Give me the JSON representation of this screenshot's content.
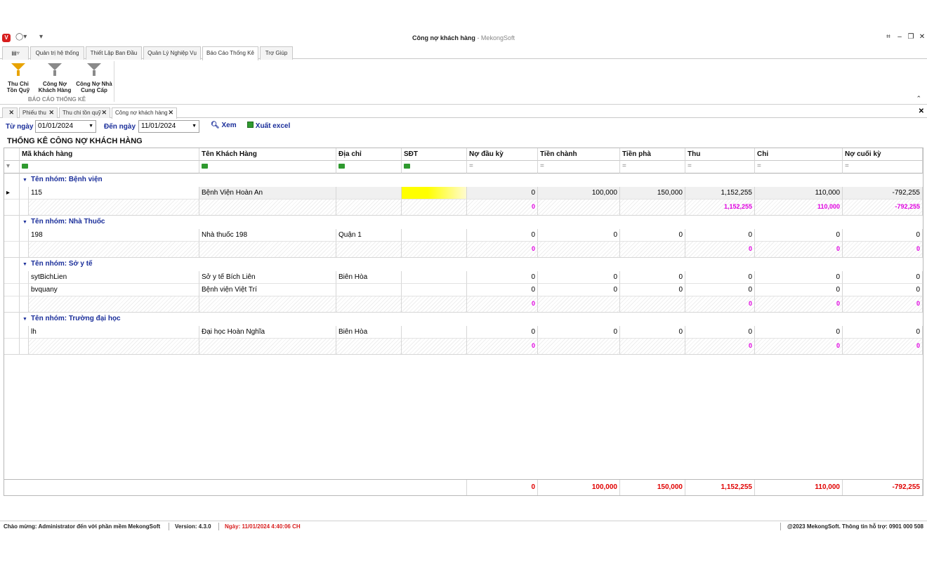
{
  "window": {
    "title": "Công nợ khách hàng",
    "app_suffix": "- MekongSoft",
    "logo": "V"
  },
  "ribbon": {
    "tabs": [
      "Quản trị hệ thống",
      "Thiết Lập Ban Đầu",
      "Quản Lý Nghiệp Vụ",
      "Báo Cáo Thống Kê",
      "Trợ Giúp"
    ],
    "active_tab": "Báo Cáo Thống Kê",
    "buttons": [
      {
        "line1": "Thu Chi",
        "line2": "Tồn Quỹ",
        "icon": "funnel-orange-icon"
      },
      {
        "line1": "Công Nợ",
        "line2": "Khách Hàng",
        "icon": "funnel-chart-icon"
      },
      {
        "line1": "Công Nợ Nhà",
        "line2": "Cung Cấp",
        "icon": "funnel-clock-icon"
      }
    ],
    "group_label": "BÁO CÁO THỐNG KÊ"
  },
  "doc_tabs": [
    "Phiếu thu",
    "Thu chi tồn quỹ",
    "Công nợ khách hàng"
  ],
  "filter": {
    "from_label": "Từ ngày",
    "from_value": "01/01/2024",
    "to_label": "Đến ngày",
    "to_value": "11/01/2024",
    "view_label": "Xem",
    "excel_label": "Xuất excel"
  },
  "report_title": "THỐNG KÊ CÔNG NỢ KHÁCH HÀNG",
  "columns": [
    "Mã khách hàng",
    "Tên Khách Hàng",
    "Địa chỉ",
    "SĐT",
    "Nợ đầu kỳ",
    "Tiền chành",
    "Tiền phà",
    "Thu",
    "Chi",
    "Nợ cuối kỳ"
  ],
  "groups": [
    {
      "label": "Tên nhóm: Bệnh viện",
      "rows": [
        {
          "ma": "115",
          "ten": "Bệnh Viện Hoàn An",
          "diachi": "",
          "sdt": "",
          "nodau": "0",
          "chanh": "100,000",
          "pha": "150,000",
          "thu": "1,152,255",
          "chi": "110,000",
          "nocuoi": "-792,255"
        }
      ],
      "sub": {
        "nodau": "0",
        "chanh": "",
        "pha": "",
        "thu": "1,152,255",
        "chi": "110,000",
        "nocuoi": "-792,255"
      }
    },
    {
      "label": "Tên nhóm: Nhà Thuốc",
      "rows": [
        {
          "ma": "198",
          "ten": "Nhà thuốc 198",
          "diachi": "Quận 1",
          "sdt": "",
          "nodau": "0",
          "chanh": "0",
          "pha": "0",
          "thu": "0",
          "chi": "0",
          "nocuoi": "0"
        }
      ],
      "sub": {
        "nodau": "0",
        "chanh": "",
        "pha": "",
        "thu": "0",
        "chi": "0",
        "nocuoi": "0"
      }
    },
    {
      "label": "Tên nhóm: Sở y tế",
      "rows": [
        {
          "ma": "sytBichLien",
          "ten": "Sở y tế  Bích Liên",
          "diachi": "Biên Hòa",
          "sdt": "",
          "nodau": "0",
          "chanh": "0",
          "pha": "0",
          "thu": "0",
          "chi": "0",
          "nocuoi": "0"
        },
        {
          "ma": "bvquany",
          "ten": "Bệnh viện Việt Trí",
          "diachi": "",
          "sdt": "",
          "nodau": "0",
          "chanh": "0",
          "pha": "0",
          "thu": "0",
          "chi": "0",
          "nocuoi": "0"
        }
      ],
      "sub": {
        "nodau": "0",
        "chanh": "",
        "pha": "",
        "thu": "0",
        "chi": "0",
        "nocuoi": "0"
      }
    },
    {
      "label": "Tên nhóm: Trường đại học",
      "rows": [
        {
          "ma": "lh",
          "ten": "Đại học Hoàn Nghĩa",
          "diachi": "Biên Hòa",
          "sdt": "",
          "nodau": "0",
          "chanh": "0",
          "pha": "0",
          "thu": "0",
          "chi": "0",
          "nocuoi": "0"
        }
      ],
      "sub": {
        "nodau": "0",
        "chanh": "",
        "pha": "",
        "thu": "0",
        "chi": "0",
        "nocuoi": "0"
      }
    }
  ],
  "totals": {
    "nodau": "0",
    "chanh": "100,000",
    "pha": "150,000",
    "thu": "1,152,255",
    "chi": "110,000",
    "nocuoi": "-792,255"
  },
  "status": {
    "welcome": "Chào mừng: Administrator đến với phần mềm MekongSoft",
    "version": "Version: 4.3.0",
    "date": "Ngày: 11/01/2024 4:40:06 CH",
    "copyright": "@2023 MekongSoft. Thông tin hỗ trợ: 0901 000 508"
  },
  "colors": {
    "accent": "#1a2e9a",
    "subtotal": "#e000e0",
    "total": "#e00000",
    "highlight": "#ffff00"
  }
}
